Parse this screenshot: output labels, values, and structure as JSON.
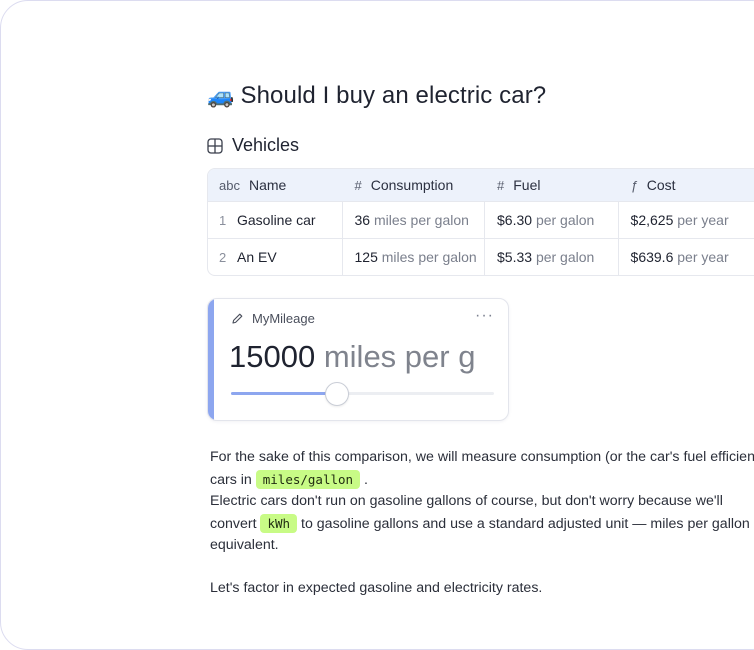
{
  "page": {
    "title_emoji": "🚙",
    "title": "Should I buy an electric car?"
  },
  "table": {
    "section_label": "Vehicles",
    "columns": [
      {
        "icon": "abc",
        "label": "Name"
      },
      {
        "icon": "#",
        "label": "Consumption"
      },
      {
        "icon": "#",
        "label": "Fuel"
      },
      {
        "icon": "ƒ",
        "label": "Cost"
      }
    ],
    "rows": [
      {
        "index": "1",
        "name": "Gasoline car",
        "consumption": "36",
        "consumption_unit": "miles per galon",
        "fuel": "$6.30",
        "fuel_unit": "per galon",
        "cost": "$2,625",
        "cost_unit": "per year"
      },
      {
        "index": "2",
        "name": "An EV",
        "consumption": "125",
        "consumption_unit": "miles per galon",
        "fuel": "$5.33",
        "fuel_unit": "per galon",
        "cost": "$639.6",
        "cost_unit": "per year"
      }
    ]
  },
  "slider": {
    "name": "MyMileage",
    "more_label": "···",
    "value": "15000",
    "unit": "miles per g",
    "fraction": 0.4
  },
  "prose": {
    "p1_line1": "For the sake of this comparison, we will measure consumption (or the car's fuel efficiency",
    "p1_line2_pre": "cars in",
    "p1_code1": "miles/gallon",
    "p1_line2_post": ".",
    "p2_line1": "Electric cars don't run on gasoline gallons of course, but don't worry because we'll",
    "p2_line2_pre": "convert",
    "p2_code": "kWh",
    "p2_line2_post": "to gasoline gallons and use a standard adjusted unit — miles per gallon of",
    "p2_line3": "equivalent.",
    "p3": "Let's factor in expected gasoline and electricity rates."
  }
}
